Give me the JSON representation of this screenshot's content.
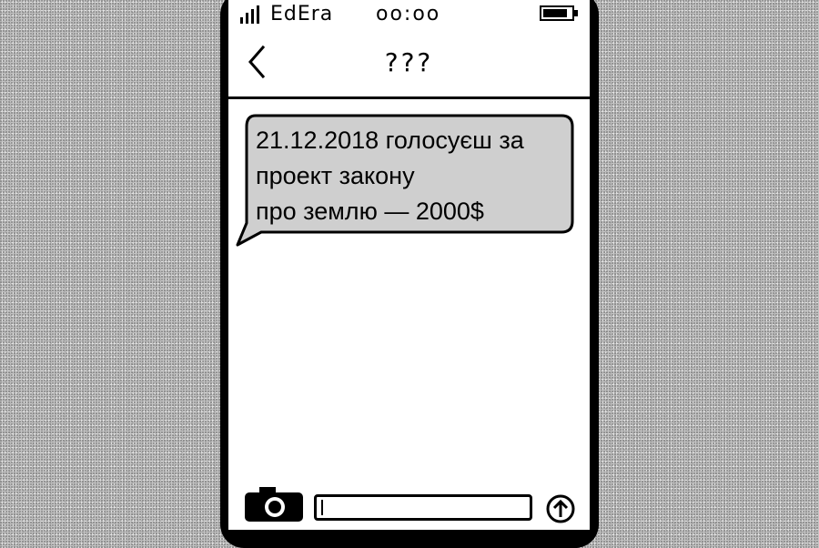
{
  "status_bar": {
    "carrier": "EdEra",
    "time": "oo:oo",
    "signal_icon": "signal-bars-icon",
    "battery_icon": "battery-full-icon"
  },
  "nav": {
    "back_icon": "chevron-left-icon",
    "title": "???"
  },
  "messages": [
    {
      "direction": "incoming",
      "lines": [
        "21.12.2018 голосуєш за",
        "проект закону",
        "про землю — 2000$"
      ]
    }
  ],
  "composer": {
    "camera_icon": "camera-icon",
    "input_value": "",
    "send_icon": "send-arrow-up-icon"
  },
  "colors": {
    "background_noise": "#c4c4c4",
    "phone_frame": "#000000",
    "screen": "#ffffff",
    "bubble_fill": "#cfcfcf"
  }
}
